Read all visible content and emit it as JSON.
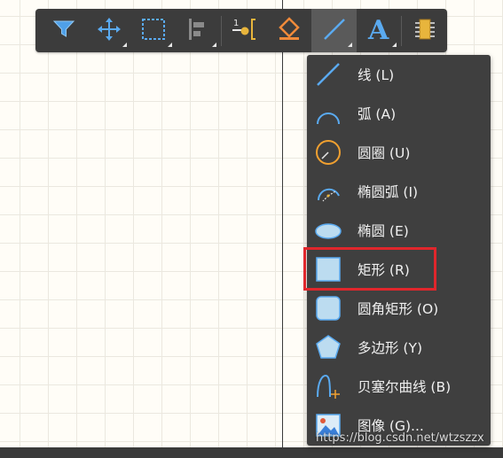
{
  "toolbar": {
    "tools": [
      {
        "icon": "filter-icon"
      },
      {
        "icon": "move-icon"
      },
      {
        "icon": "select-rect-icon"
      },
      {
        "icon": "align-icon"
      },
      {
        "icon": "place-pin-icon",
        "text": "1"
      },
      {
        "icon": "fill-icon"
      },
      {
        "icon": "line-icon",
        "active": true
      },
      {
        "icon": "text-icon"
      },
      {
        "icon": "component-icon"
      }
    ]
  },
  "menu": {
    "items": [
      {
        "label": "线 (L)",
        "icon": "line-icon"
      },
      {
        "label": "弧 (A)",
        "icon": "arc-icon"
      },
      {
        "label": "圆圈 (U)",
        "icon": "circle-icon"
      },
      {
        "label": "椭圆弧 (I)",
        "icon": "elliptical-arc-icon"
      },
      {
        "label": "椭圆 (E)",
        "icon": "ellipse-icon"
      },
      {
        "label": "矩形 (R)",
        "icon": "rectangle-icon"
      },
      {
        "label": "圆角矩形 (O)",
        "icon": "round-rectangle-icon"
      },
      {
        "label": "多边形 (Y)",
        "icon": "polygon-icon"
      },
      {
        "label": "贝塞尔曲线 (B)",
        "icon": "bezier-icon"
      },
      {
        "label": "图像 (G)...",
        "icon": "image-icon"
      }
    ]
  },
  "highlight_label": "矩形 (R)",
  "watermark": "https://blog.csdn.net/wtzszzx"
}
